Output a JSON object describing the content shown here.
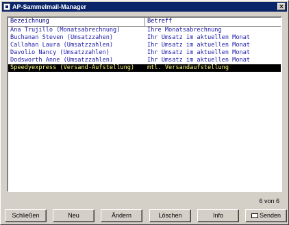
{
  "window": {
    "title": "AP-Sammelmail-Manager",
    "close_glyph": "×"
  },
  "list": {
    "headers": [
      "Bezeichnung",
      "Betreff"
    ],
    "rows": [
      [
        "Ana Trujillo (Monatsabrechnung)",
        "Ihre Monatsabrechnung"
      ],
      [
        "Buchanan Steven (Umsatzzahen)",
        "Ihr Umsatz im aktuellen Monat"
      ],
      [
        "Callahan Laura (Umsatzzahlen)",
        "Ihr Umsatz im aktuellen Monat"
      ],
      [
        "Davolio Nancy (Umsatzzahlen)",
        "Ihr Umsatz im aktuellen Monat"
      ],
      [
        "Dodsworth Anne (Umsatzzahlen)",
        "Ihr Umsatz im aktuellen Monat"
      ],
      [
        "Speedyexpress (Versand-Aufstellung)",
        "mtl. Versandaufstellung"
      ]
    ],
    "selected_index": 5
  },
  "status": {
    "record_count": "6 von 6"
  },
  "buttons": {
    "close": "Schließen",
    "new": "Neu",
    "edit": "Ändern",
    "delete": "Löschen",
    "info": "Info",
    "send": "Senden"
  },
  "colors": {
    "title_bar": "#0a246a",
    "list_text": "#1a1aa8",
    "selected_bg": "#000000",
    "selected_text": "#ffff80",
    "face": "#d4d0c8"
  }
}
